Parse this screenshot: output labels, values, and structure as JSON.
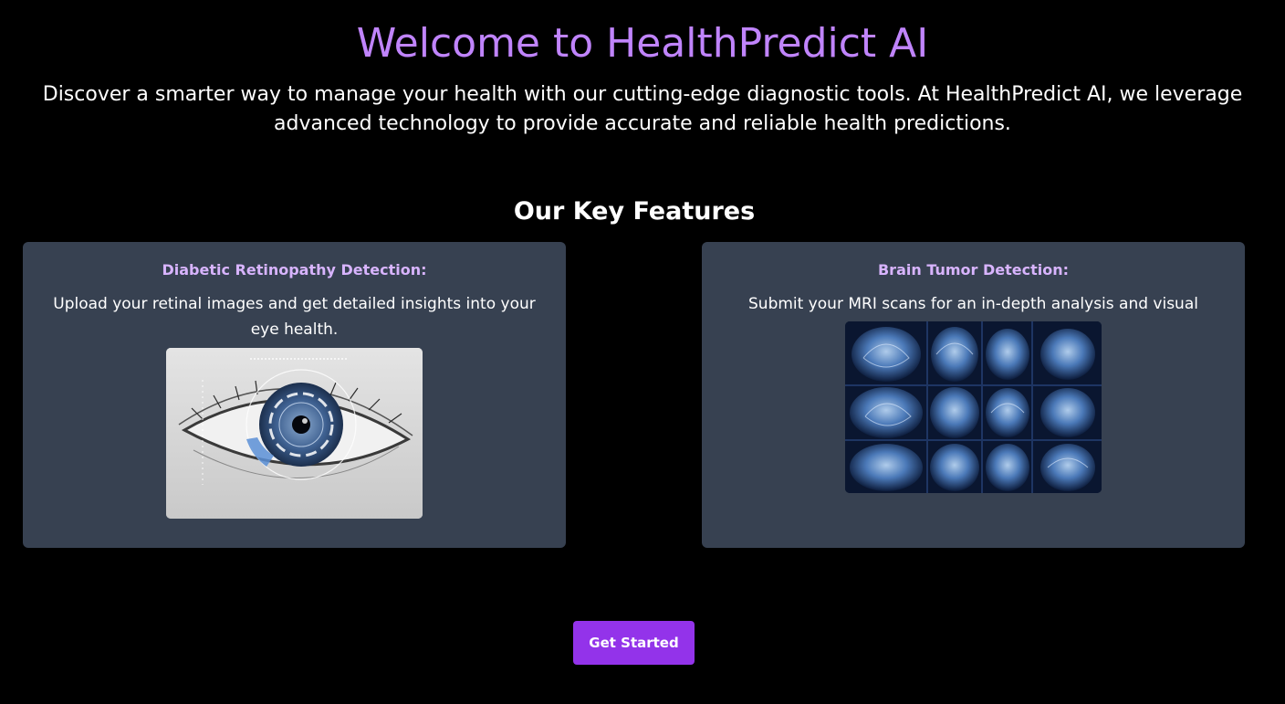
{
  "hero": {
    "title": "Welcome to HealthPredict AI",
    "description": "Discover a smarter way to manage your health with our cutting-edge diagnostic tools. At HealthPredict AI, we leverage advanced technology to provide accurate and reliable health predictions."
  },
  "features": {
    "heading": "Our Key Features",
    "items": [
      {
        "title": "Diabetic Retinopathy Detection:",
        "text": "Upload your retinal images and get detailed insights into your eye health.",
        "image": "eye-scan-image"
      },
      {
        "title": "Brain Tumor Detection:",
        "text": "Submit your MRI scans for an in-depth analysis and visual results.",
        "image": "brain-mri-image"
      }
    ]
  },
  "cta": {
    "label": "Get Started"
  },
  "colors": {
    "background": "#000000",
    "accent": "#c084fc",
    "card_title": "#d8b4fe",
    "card_bg": "#374151",
    "button": "#9333ea"
  }
}
